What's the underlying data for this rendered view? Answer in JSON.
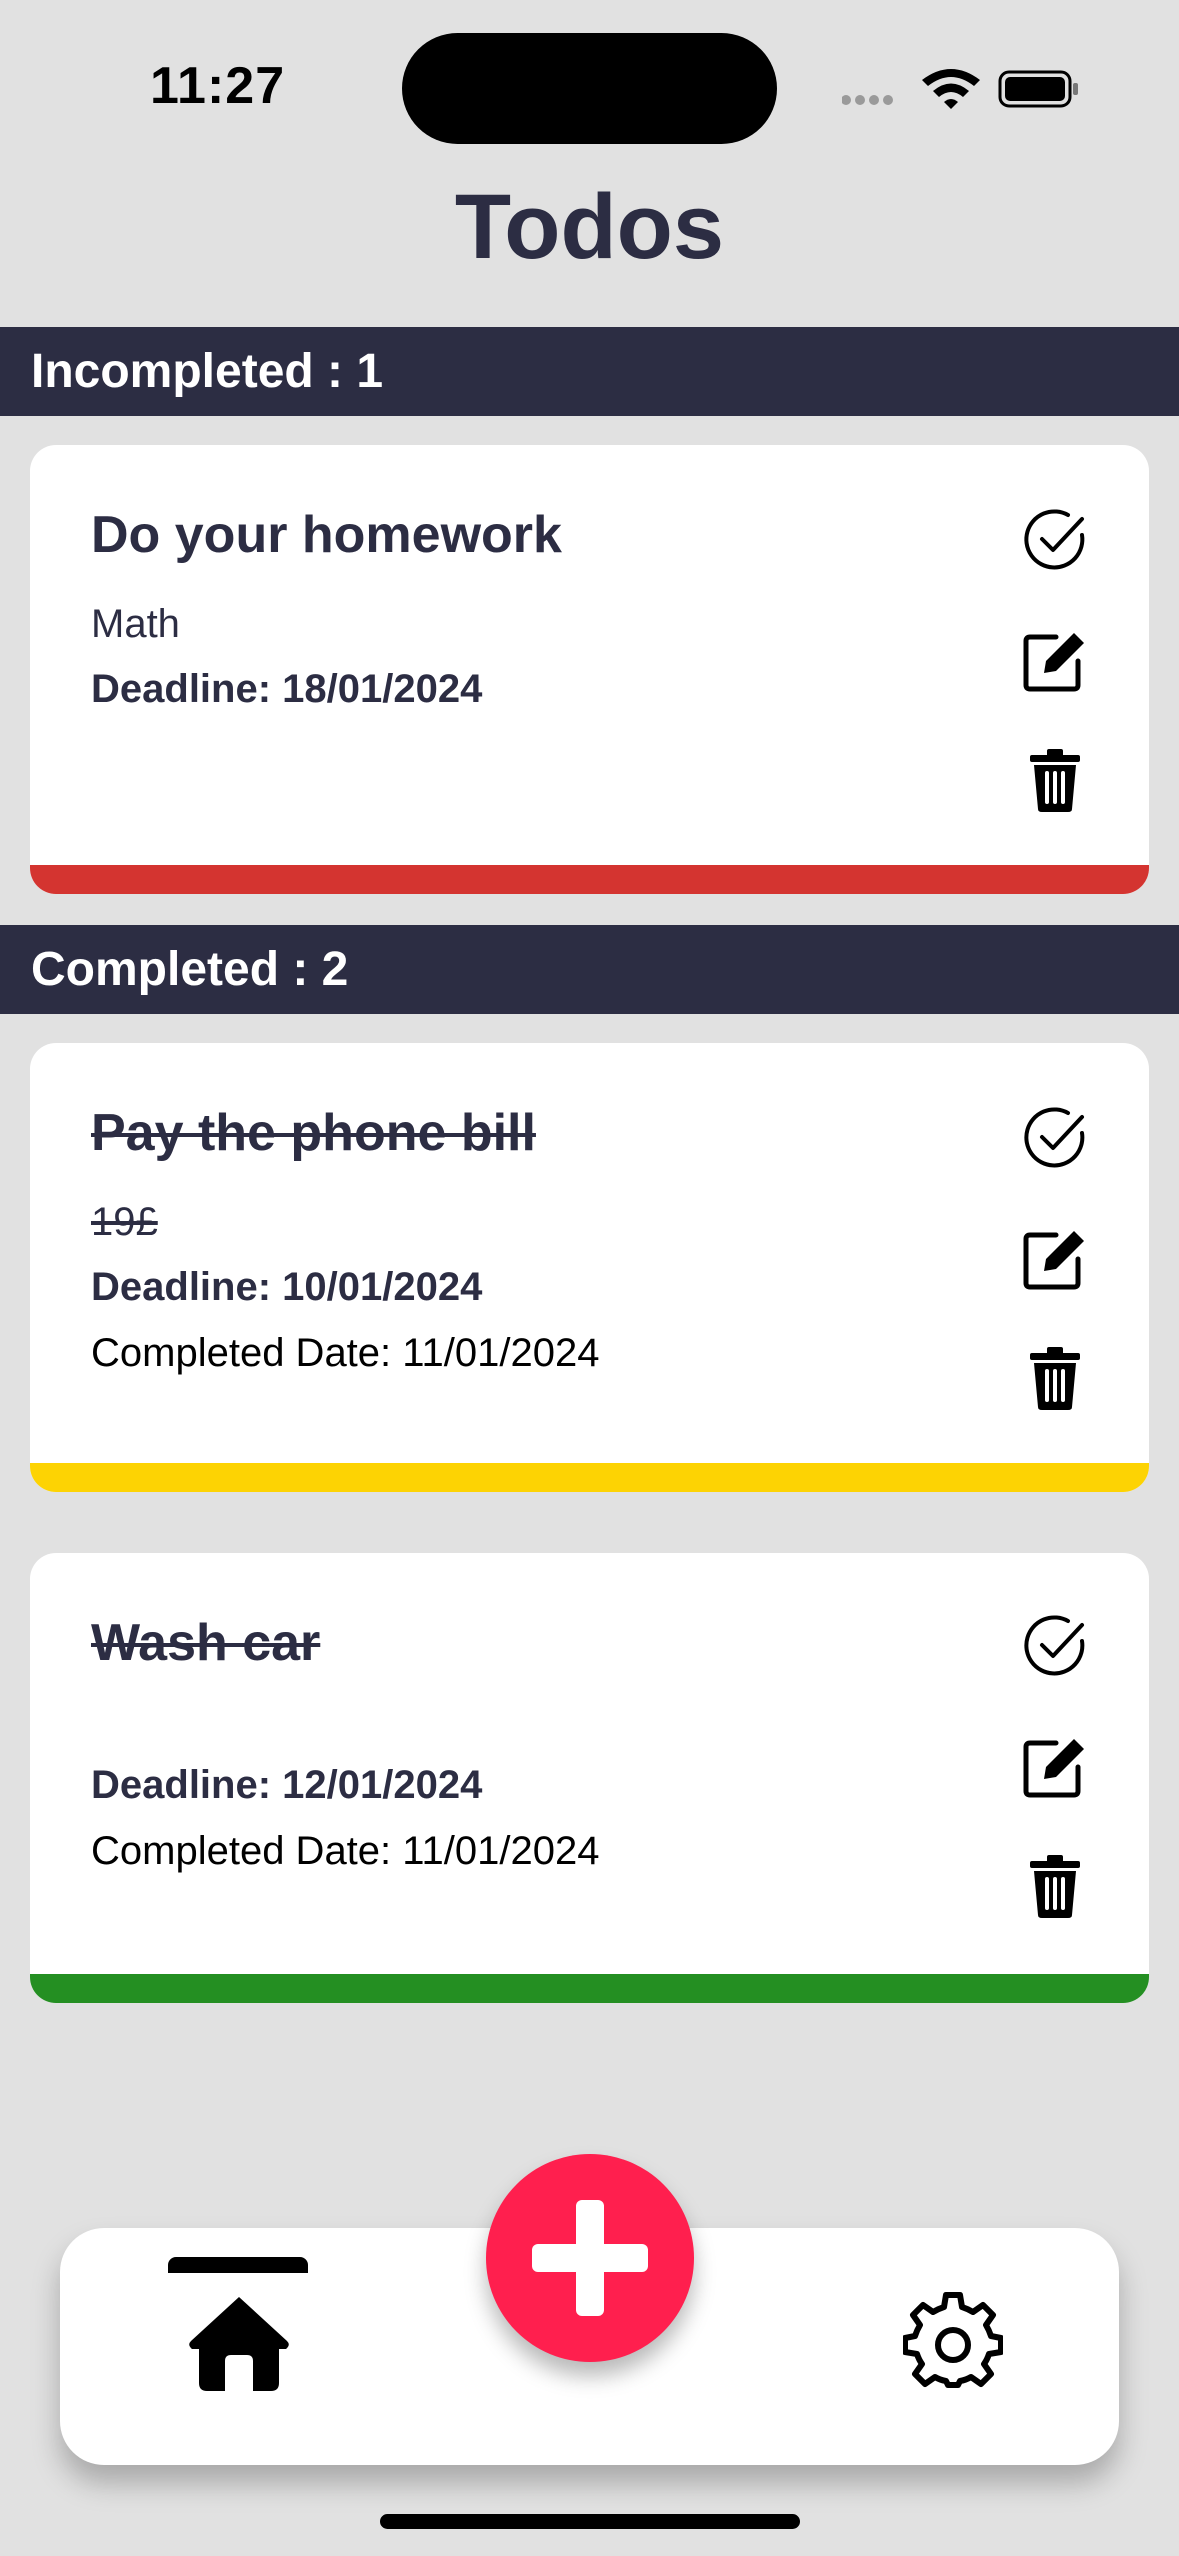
{
  "status_bar": {
    "time": "11:27"
  },
  "header": {
    "title": "Todos"
  },
  "sections": {
    "incompleted": {
      "label": "Incompleted : 1"
    },
    "completed": {
      "label": "Completed : 2"
    }
  },
  "todos": [
    {
      "title": "Do your homework",
      "description": "Math",
      "deadline": "Deadline: 18/01/2024",
      "completed_date": "",
      "done": false,
      "priority_color": "#d43430"
    },
    {
      "title": "Pay the phone bill",
      "description": "19£",
      "deadline": "Deadline: 10/01/2024",
      "completed_date": "Completed Date: 11/01/2024",
      "done": true,
      "priority_color": "#fdd303"
    },
    {
      "title": "Wash car",
      "description": "",
      "deadline": "Deadline: 12/01/2024",
      "completed_date": "Completed Date: 11/01/2024",
      "done": true,
      "priority_color": "#248f22"
    }
  ],
  "icons": {
    "complete": "check-circle-icon",
    "edit": "edit-icon",
    "delete": "trash-icon",
    "home": "home-icon",
    "settings": "gear-icon",
    "add": "plus-icon"
  },
  "colors": {
    "background": "#e1e1e1",
    "header_bg": "#2c2d43",
    "accent": "#ff1f4e"
  }
}
